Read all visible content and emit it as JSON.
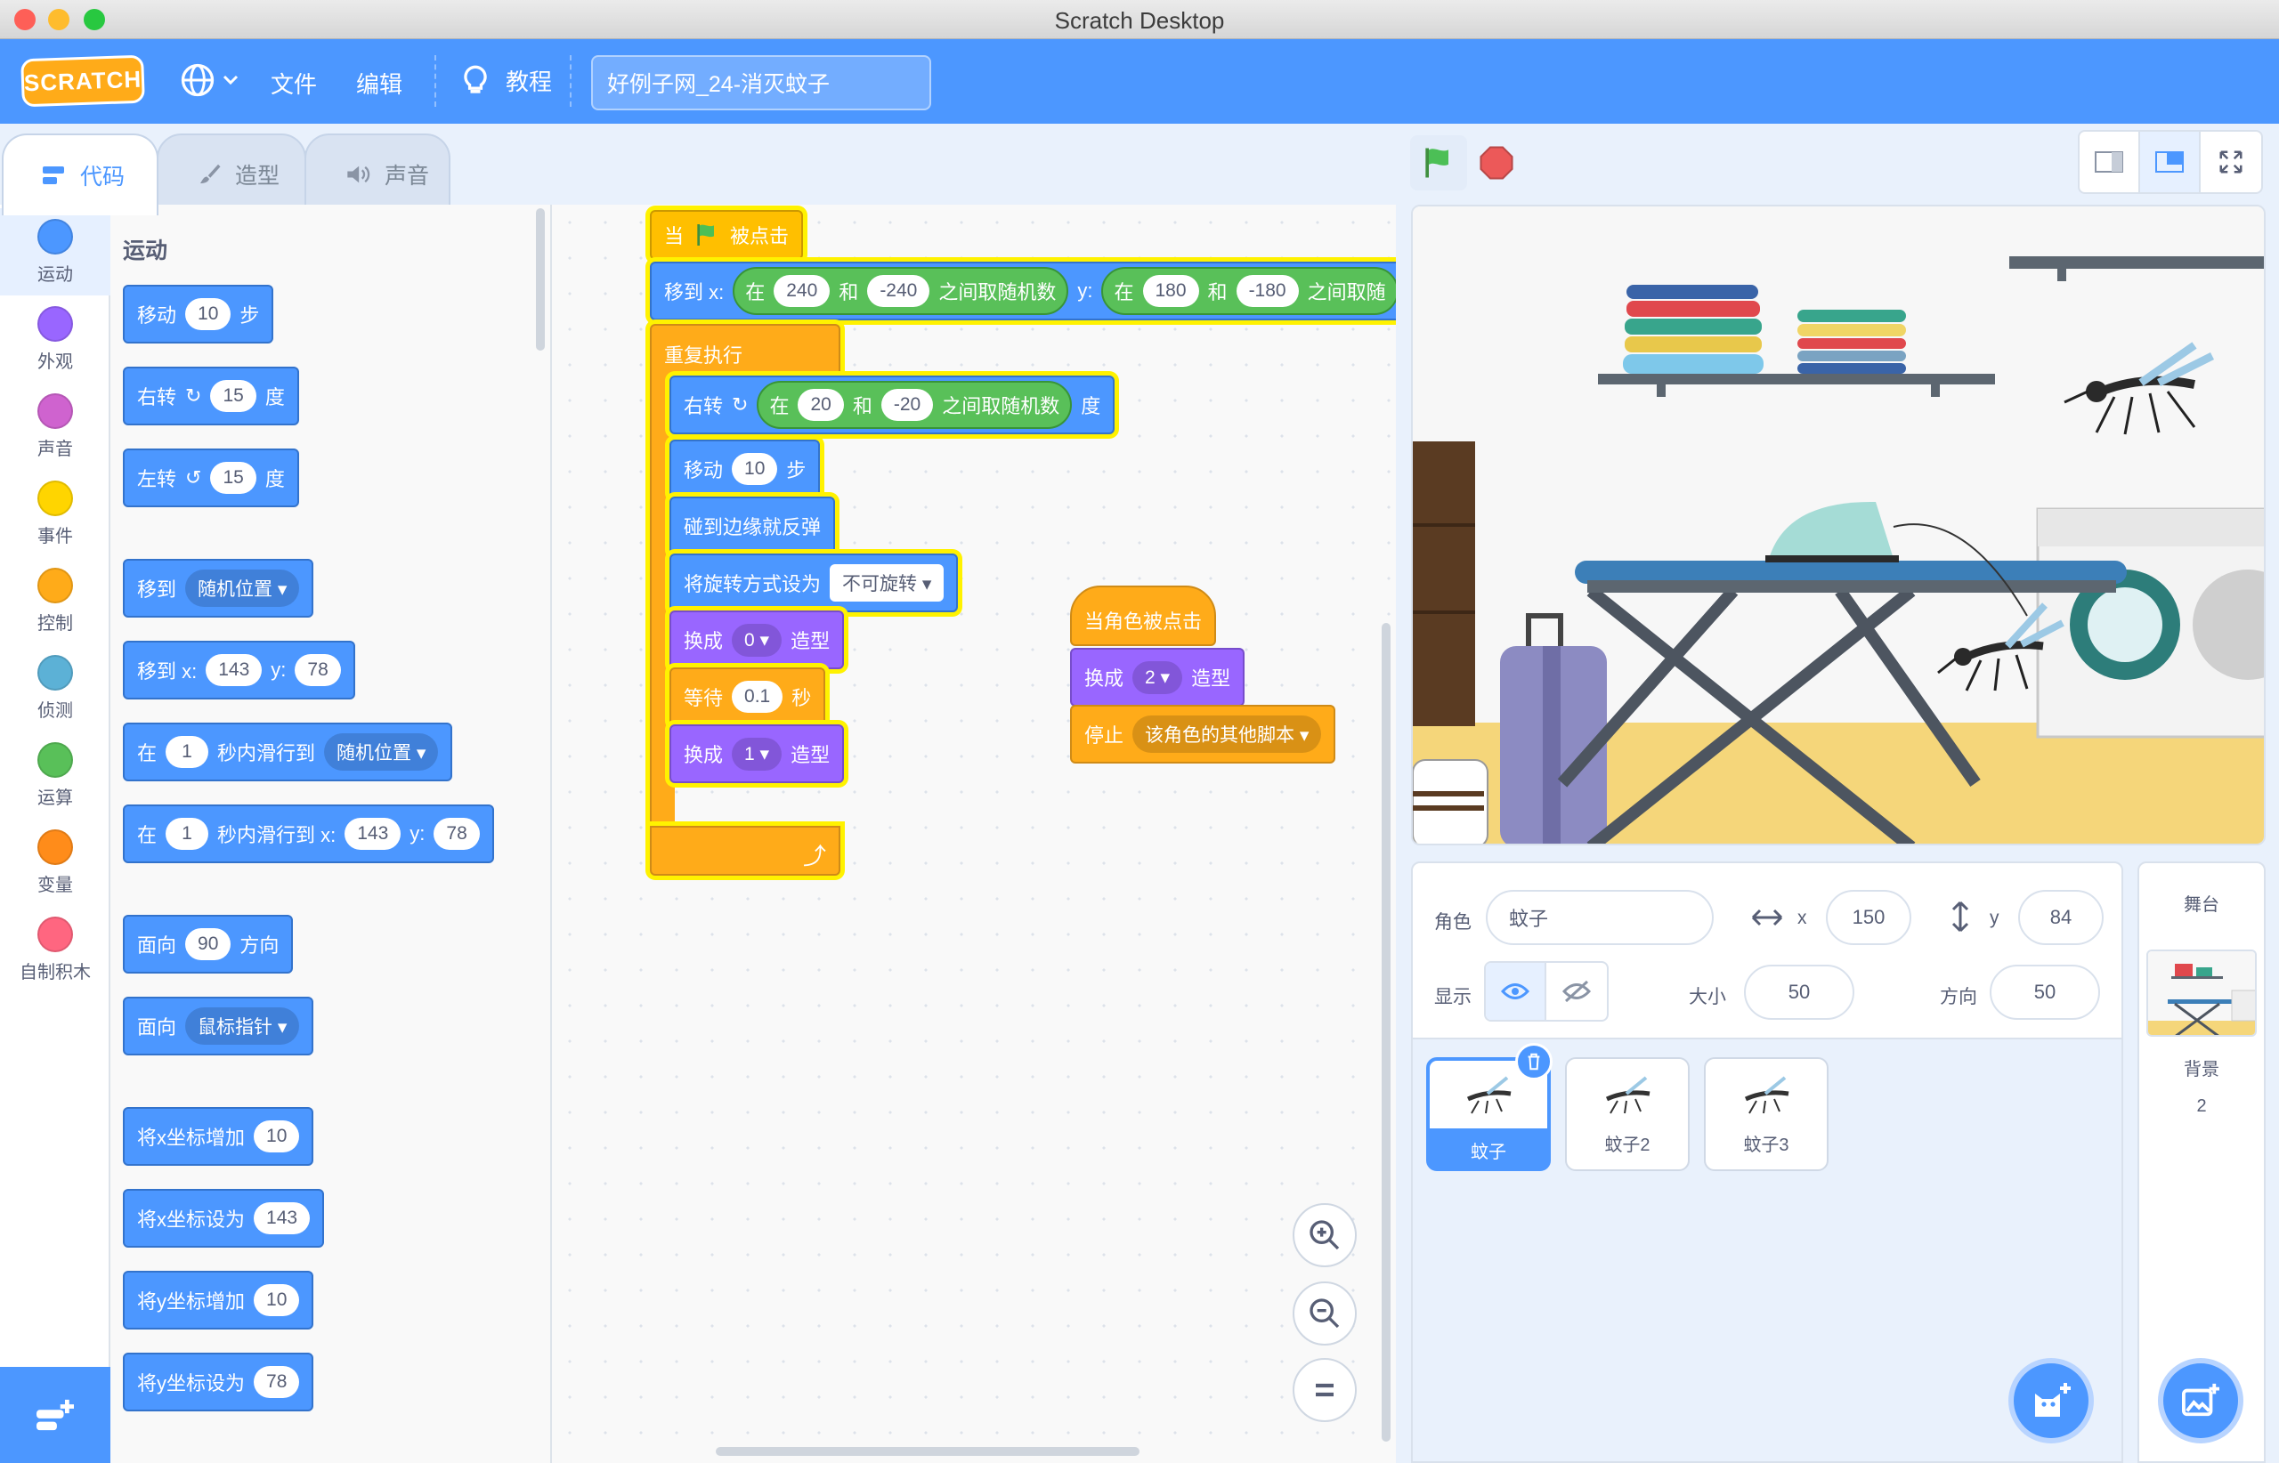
{
  "window": {
    "title": "Scratch Desktop"
  },
  "menubar": {
    "logo": "SCRATCH",
    "language_icon": "globe-icon",
    "file_label": "文件",
    "edit_label": "编辑",
    "tutorials_label": "教程",
    "project_title": "好例子网_24-消灭蚊子"
  },
  "tabs": [
    {
      "label": "代码",
      "icon": "code-icon"
    },
    {
      "label": "造型",
      "icon": "brush-icon"
    },
    {
      "label": "声音",
      "icon": "speaker-icon"
    }
  ],
  "categories": [
    {
      "label": "运动",
      "color": "#4c97ff"
    },
    {
      "label": "外观",
      "color": "#9966ff"
    },
    {
      "label": "声音",
      "color": "#cf63cf"
    },
    {
      "label": "事件",
      "color": "#ffd500"
    },
    {
      "label": "控制",
      "color": "#ffab19"
    },
    {
      "label": "侦测",
      "color": "#5cb1d6"
    },
    {
      "label": "运算",
      "color": "#59c059"
    },
    {
      "label": "变量",
      "color": "#ff8c1a"
    },
    {
      "label": "自制积木",
      "color": "#ff6680"
    }
  ],
  "palette": {
    "heading": "运动",
    "move": {
      "a": "移动",
      "v": "10",
      "b": "步"
    },
    "turn_right": {
      "a": "右转",
      "v": "15",
      "b": "度"
    },
    "turn_left": {
      "a": "左转",
      "v": "15",
      "b": "度"
    },
    "goto": {
      "a": "移到",
      "dd": "随机位置"
    },
    "goto_xy": {
      "a": "移到 x:",
      "x": "143",
      "yl": "y:",
      "y": "78"
    },
    "glide": {
      "a": "在",
      "v": "1",
      "b": "秒内滑行到",
      "dd": "随机位置"
    },
    "glide_xy": {
      "a": "在",
      "v": "1",
      "b": "秒内滑行到 x:",
      "x": "143",
      "yl": "y:",
      "y": "78"
    },
    "point_dir": {
      "a": "面向",
      "v": "90",
      "b": "方向"
    },
    "point_towards": {
      "a": "面向",
      "dd": "鼠标指针"
    },
    "change_x": {
      "a": "将x坐标增加",
      "v": "10"
    },
    "set_x": {
      "a": "将x坐标设为",
      "v": "143"
    },
    "change_y": {
      "a": "将y坐标增加",
      "v": "10"
    },
    "set_y": {
      "a": "将y坐标设为",
      "v": "78"
    }
  },
  "script1": {
    "hat": {
      "a": "当",
      "b": "被点击"
    },
    "goto": {
      "a": "移到 x:",
      "in1": "在",
      "v1": "240",
      "and1": "和",
      "v2": "-240",
      "rand1": "之间取随机数",
      "yl": "y:",
      "in2": "在",
      "v3": "180",
      "and2": "和",
      "v4": "-180",
      "rand2": "之间取随"
    },
    "forever": "重复执行",
    "turn": {
      "a": "右转",
      "in": "在",
      "v1": "20",
      "and": "和",
      "v2": "-20",
      "rand": "之间取随机数",
      "b": "度"
    },
    "move": {
      "a": "移动",
      "v": "10",
      "b": "步"
    },
    "bounce": "碰到边缘就反弹",
    "rotstyle": {
      "a": "将旋转方式设为",
      "dd": "不可旋转"
    },
    "costume0": {
      "a": "换成",
      "dd": "0",
      "b": "造型"
    },
    "wait": {
      "a": "等待",
      "v": "0.1",
      "b": "秒"
    },
    "costume1": {
      "a": "换成",
      "dd": "1",
      "b": "造型"
    }
  },
  "script2": {
    "hat": "当角色被点击",
    "costume": {
      "a": "换成",
      "dd": "2",
      "b": "造型"
    },
    "stop": {
      "a": "停止",
      "dd": "该角色的其他脚本"
    }
  },
  "sprite_info": {
    "sprite_label": "角色",
    "sprite_name": "蚊子",
    "x_label": "x",
    "x": "150",
    "y_label": "y",
    "y": "84",
    "show_label": "显示",
    "size_label": "大小",
    "size": "50",
    "direction_label": "方向",
    "direction": "50"
  },
  "sprites": [
    {
      "name": "蚊子",
      "selected": true
    },
    {
      "name": "蚊子2",
      "selected": false
    },
    {
      "name": "蚊子3",
      "selected": false
    }
  ],
  "stage_panel": {
    "title": "舞台",
    "backdrops_label": "背景",
    "backdrops_count": "2"
  }
}
